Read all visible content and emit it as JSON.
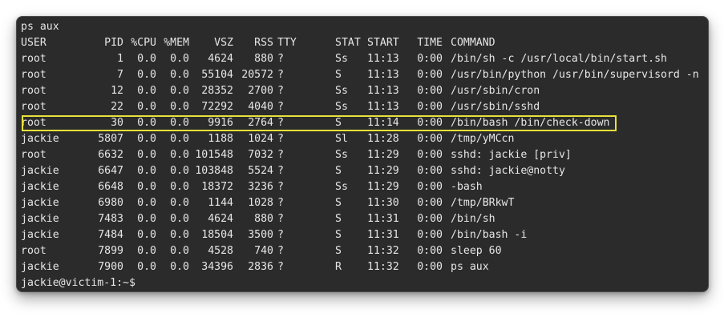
{
  "terminal": {
    "command_line": "ps aux",
    "prompt": "jackie@victim-1:~$",
    "highlight_color": "#e8e03a",
    "background_color": "#2b2b2b",
    "text_color": "#e6e6e6"
  },
  "table": {
    "headers": {
      "user": "USER",
      "pid": "PID",
      "cpu": "%CPU",
      "mem": "%MEM",
      "vsz": "VSZ",
      "rss": "RSS",
      "tty": "TTY",
      "stat": "STAT",
      "start": "START",
      "time": "TIME",
      "command": "COMMAND"
    },
    "rows": [
      {
        "user": "root",
        "pid": "1",
        "cpu": "0.0",
        "mem": "0.0",
        "vsz": "4624",
        "rss": "880",
        "tty": "?",
        "stat": "Ss",
        "start": "11:13",
        "time": "0:00",
        "command": "/bin/sh -c /usr/local/bin/start.sh"
      },
      {
        "user": "root",
        "pid": "7",
        "cpu": "0.0",
        "mem": "0.0",
        "vsz": "55104",
        "rss": "20572",
        "tty": "?",
        "stat": "S",
        "start": "11:13",
        "time": "0:00",
        "command": "/usr/bin/python /usr/bin/supervisord -n"
      },
      {
        "user": "root",
        "pid": "12",
        "cpu": "0.0",
        "mem": "0.0",
        "vsz": "28352",
        "rss": "2700",
        "tty": "?",
        "stat": "Ss",
        "start": "11:13",
        "time": "0:00",
        "command": "/usr/sbin/cron"
      },
      {
        "user": "root",
        "pid": "22",
        "cpu": "0.0",
        "mem": "0.0",
        "vsz": "72292",
        "rss": "4040",
        "tty": "?",
        "stat": "Ss",
        "start": "11:13",
        "time": "0:00",
        "command": "/usr/sbin/sshd"
      },
      {
        "user": "root",
        "pid": "30",
        "cpu": "0.0",
        "mem": "0.0",
        "vsz": "9916",
        "rss": "2764",
        "tty": "?",
        "stat": "S",
        "start": "11:14",
        "time": "0:00",
        "command": "/bin/bash /bin/check-down"
      },
      {
        "user": "jackie",
        "pid": "5807",
        "cpu": "0.0",
        "mem": "0.0",
        "vsz": "1188",
        "rss": "1024",
        "tty": "?",
        "stat": "Sl",
        "start": "11:28",
        "time": "0:00",
        "command": "/tmp/yMCcn"
      },
      {
        "user": "root",
        "pid": "6632",
        "cpu": "0.0",
        "mem": "0.0",
        "vsz": "101548",
        "rss": "7032",
        "tty": "?",
        "stat": "Ss",
        "start": "11:29",
        "time": "0:00",
        "command": "sshd: jackie [priv]"
      },
      {
        "user": "jackie",
        "pid": "6647",
        "cpu": "0.0",
        "mem": "0.0",
        "vsz": "103848",
        "rss": "5524",
        "tty": "?",
        "stat": "S",
        "start": "11:29",
        "time": "0:00",
        "command": "sshd: jackie@notty"
      },
      {
        "user": "jackie",
        "pid": "6648",
        "cpu": "0.0",
        "mem": "0.0",
        "vsz": "18372",
        "rss": "3236",
        "tty": "?",
        "stat": "Ss",
        "start": "11:29",
        "time": "0:00",
        "command": "-bash"
      },
      {
        "user": "jackie",
        "pid": "6980",
        "cpu": "0.0",
        "mem": "0.0",
        "vsz": "1144",
        "rss": "1028",
        "tty": "?",
        "stat": "S",
        "start": "11:30",
        "time": "0:00",
        "command": "/tmp/BRkwT"
      },
      {
        "user": "jackie",
        "pid": "7483",
        "cpu": "0.0",
        "mem": "0.0",
        "vsz": "4624",
        "rss": "880",
        "tty": "?",
        "stat": "S",
        "start": "11:31",
        "time": "0:00",
        "command": "/bin/sh"
      },
      {
        "user": "jackie",
        "pid": "7484",
        "cpu": "0.0",
        "mem": "0.0",
        "vsz": "18504",
        "rss": "3500",
        "tty": "?",
        "stat": "S",
        "start": "11:31",
        "time": "0:00",
        "command": "/bin/bash -i"
      },
      {
        "user": "root",
        "pid": "7899",
        "cpu": "0.0",
        "mem": "0.0",
        "vsz": "4528",
        "rss": "740",
        "tty": "?",
        "stat": "S",
        "start": "11:32",
        "time": "0:00",
        "command": "sleep 60"
      },
      {
        "user": "jackie",
        "pid": "7900",
        "cpu": "0.0",
        "mem": "0.0",
        "vsz": "34396",
        "rss": "2836",
        "tty": "?",
        "stat": "R",
        "start": "11:32",
        "time": "0:00",
        "command": "ps aux"
      }
    ]
  }
}
